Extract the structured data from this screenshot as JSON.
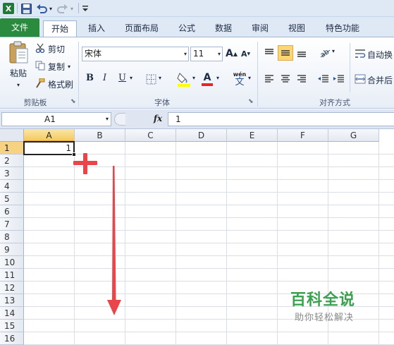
{
  "quick_access": {
    "icons": [
      "excel-logo-icon",
      "save-icon",
      "undo-icon",
      "redo-icon",
      "customize-icon"
    ]
  },
  "tabs": [
    {
      "label": "文件"
    },
    {
      "label": "开始"
    },
    {
      "label": "插入"
    },
    {
      "label": "页面布局"
    },
    {
      "label": "公式"
    },
    {
      "label": "数据"
    },
    {
      "label": "审阅"
    },
    {
      "label": "视图"
    },
    {
      "label": "特色功能"
    }
  ],
  "clipboard": {
    "paste": "粘贴",
    "cut": "剪切",
    "copy": "复制",
    "format_painter": "格式刷",
    "group_label": "剪贴板"
  },
  "font": {
    "name": "宋体",
    "size": "11",
    "grow": "A",
    "shrink": "A",
    "bold": "B",
    "italic": "I",
    "underline": "U",
    "font_color_letter": "A",
    "phonetic_top": "wén",
    "phonetic_bottom": "文",
    "group_label": "字体"
  },
  "alignment": {
    "wrap_text": "自动换",
    "merge": "合并后",
    "group_label": "对齐方式"
  },
  "formula_bar": {
    "name_box": "A1",
    "fx": "fx",
    "value": "1"
  },
  "grid": {
    "columns": [
      "A",
      "B",
      "C",
      "D",
      "E",
      "F",
      "G"
    ],
    "rows": [
      "1",
      "2",
      "3",
      "4",
      "5",
      "6",
      "7",
      "8",
      "9",
      "10",
      "11",
      "12",
      "13",
      "14",
      "15",
      "16"
    ],
    "active_cell": "A1",
    "a1_value": "1"
  },
  "annotations": {
    "fill_cursor": "+",
    "arrow": "down"
  },
  "watermark": {
    "title": "百科全说",
    "subtitle": "助你轻松解决"
  },
  "colors": {
    "file_tab": "#2a8a3e",
    "accent_red": "#e8464b",
    "watermark_green": "#3aa14e",
    "selected_header": "#f5c95d"
  }
}
